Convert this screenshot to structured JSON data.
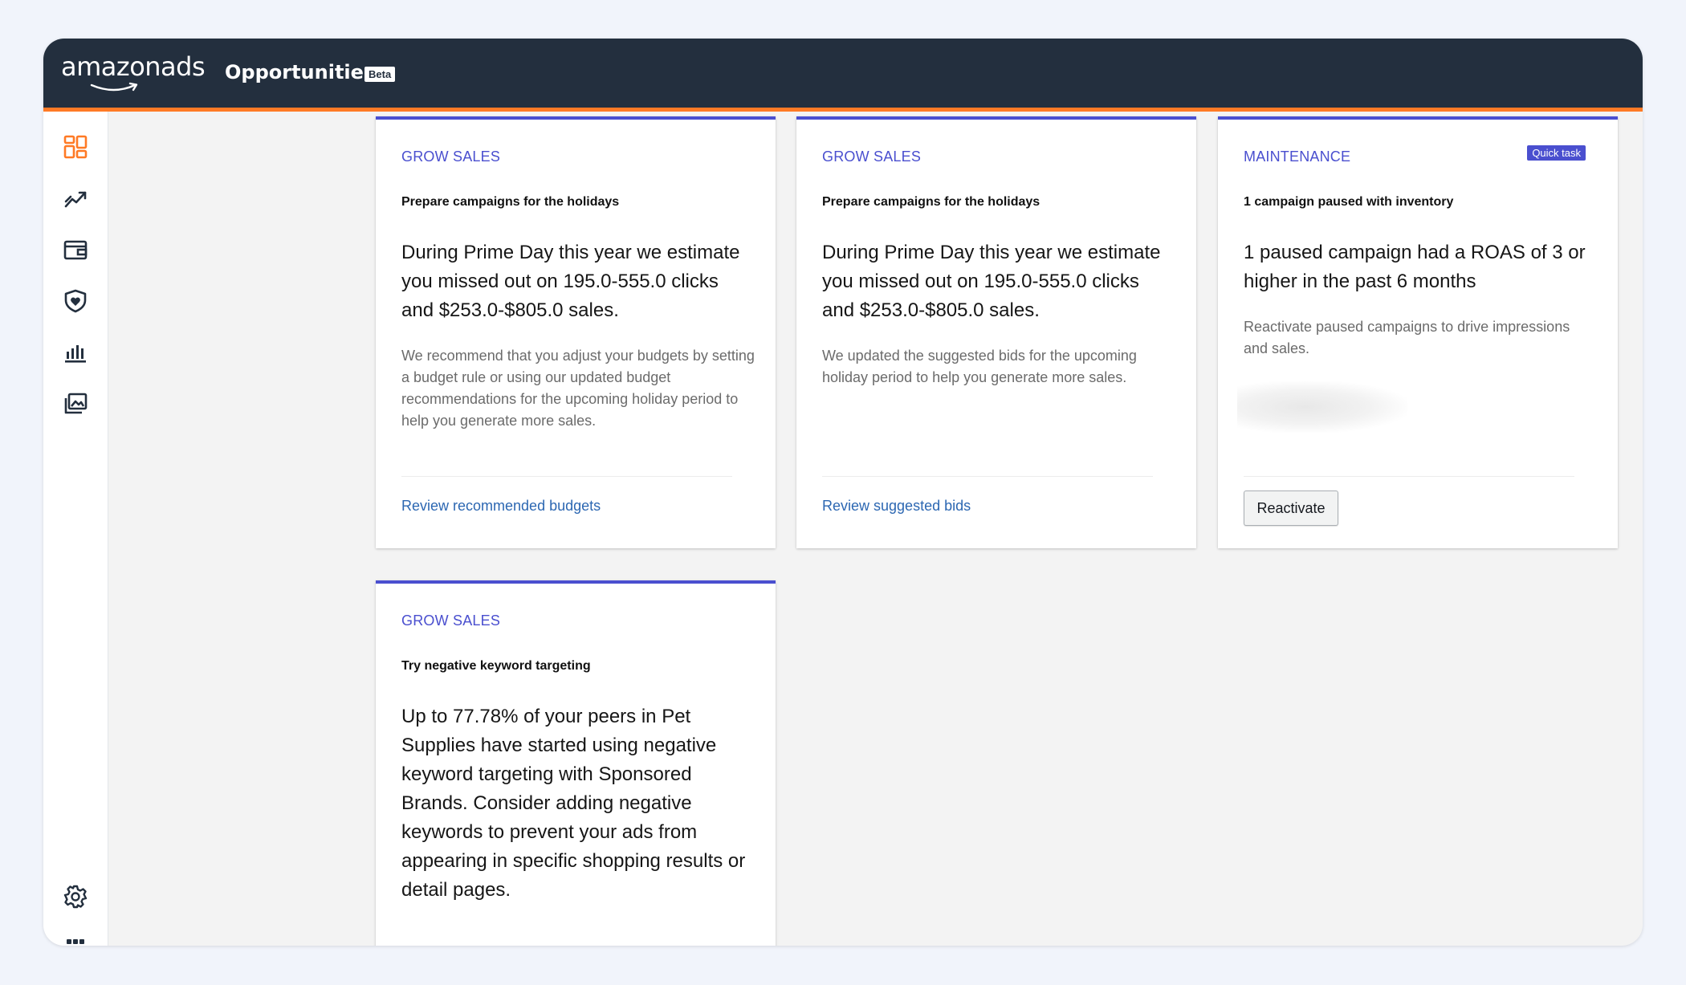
{
  "header": {
    "logo_text": "amazonads",
    "title": "Opportunities",
    "badge": "Beta",
    "colors": {
      "bar": "#232f3e",
      "accent_line": "#ff7a25"
    }
  },
  "sidebar": {
    "items": [
      {
        "name": "opportunities",
        "icon": "dashboard-grid-icon",
        "active": true
      },
      {
        "name": "campaigns",
        "icon": "trend-chart-icon"
      },
      {
        "name": "billing",
        "icon": "wallet-icon"
      },
      {
        "name": "brand-safety",
        "icon": "shield-heart-icon"
      },
      {
        "name": "reports",
        "icon": "bar-chart-icon"
      },
      {
        "name": "creative-assets",
        "icon": "image-gallery-icon"
      }
    ],
    "bottom_items": [
      {
        "name": "settings",
        "icon": "gear-icon"
      },
      {
        "name": "apps",
        "icon": "app-grid-icon"
      }
    ],
    "active_color": "#ff7a25"
  },
  "cards": [
    {
      "category": "GROW SALES",
      "subtitle": "Prepare campaigns for the holidays",
      "headline": "During Prime Day this year we estimate you missed out on 195.0-555.0 clicks and $253.0-$805.0 sales.",
      "description": "We recommend that you adjust your budgets by setting a budget rule or using our updated budget recommendations for the upcoming holiday period to help you generate more sales.",
      "action": "Review recommended budgets"
    },
    {
      "category": "GROW SALES",
      "subtitle": "Prepare campaigns for the holidays",
      "headline": "During Prime Day this year we estimate you missed out on 195.0-555.0 clicks and $253.0-$805.0 sales.",
      "description": "We updated the suggested bids for the upcoming holiday period to help you generate more sales.",
      "action": "Review suggested bids"
    },
    {
      "category": "MAINTENANCE",
      "badge": "Quick task",
      "subtitle": "1 campaign paused with inventory",
      "headline": "1 paused campaign had a ROAS of 3 or higher in the past 6 months",
      "description": "Reactivate paused campaigns to drive impressions and sales.",
      "action": "Reactivate"
    },
    {
      "category": "GROW SALES",
      "subtitle": "Try negative keyword targeting",
      "headline": "Up to 77.78% of your peers in Pet Supplies have started using negative keyword targeting with Sponsored Brands. Consider adding negative keywords to prevent your ads from appearing in specific shopping results or detail pages."
    }
  ],
  "accent_color": "#4a4fcf",
  "link_color": "#2c67b2"
}
